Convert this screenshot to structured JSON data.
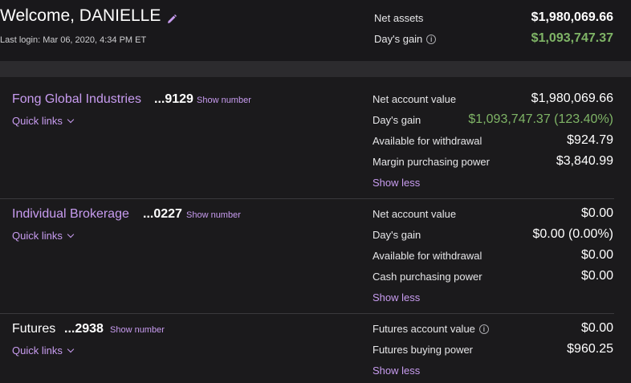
{
  "header": {
    "welcome": "Welcome, DANIELLE",
    "last_login": "Last login: Mar 06, 2020, 4:34 PM ET",
    "net_assets_label": "Net assets",
    "net_assets_value": "$1,980,069.66",
    "days_gain_label": "Day's gain",
    "days_gain_value": "$1,093,747.37"
  },
  "accounts": [
    {
      "name": "Fong Global Industries",
      "number": "...9129",
      "show_number": "Show number",
      "quick_links": "Quick links",
      "rows": [
        {
          "label": "Net account value",
          "value": "$1,980,069.66"
        },
        {
          "label": "Day's gain",
          "value": "$1,093,747.37 (123.40%)"
        },
        {
          "label": "Available for withdrawal",
          "value": "$924.79"
        },
        {
          "label": "Margin purchasing power",
          "value": "$3,840.99"
        }
      ],
      "show_less": "Show less"
    },
    {
      "name": "Individual Brokerage",
      "number": "...0227",
      "show_number": "Show number",
      "quick_links": "Quick links",
      "rows": [
        {
          "label": "Net account value",
          "value": "$0.00"
        },
        {
          "label": "Day's gain",
          "value": "$0.00 (0.00%)"
        },
        {
          "label": "Available for withdrawal",
          "value": "$0.00"
        },
        {
          "label": "Cash purchasing power",
          "value": "$0.00"
        }
      ],
      "show_less": "Show less"
    },
    {
      "name": "Futures",
      "number": "...2938",
      "show_number": "Show number",
      "quick_links": "Quick links",
      "rows": [
        {
          "label": "Futures account value",
          "value": "$0.00"
        },
        {
          "label": "Futures buying power",
          "value": "$960.25"
        }
      ],
      "show_less": "Show less"
    }
  ],
  "colors": {
    "accent": "#c89cf0",
    "gain_green": "#7fb466",
    "background": "#1b1a1c"
  },
  "icons": [
    "pencil-icon",
    "info-icon",
    "chevron-down-icon"
  ]
}
